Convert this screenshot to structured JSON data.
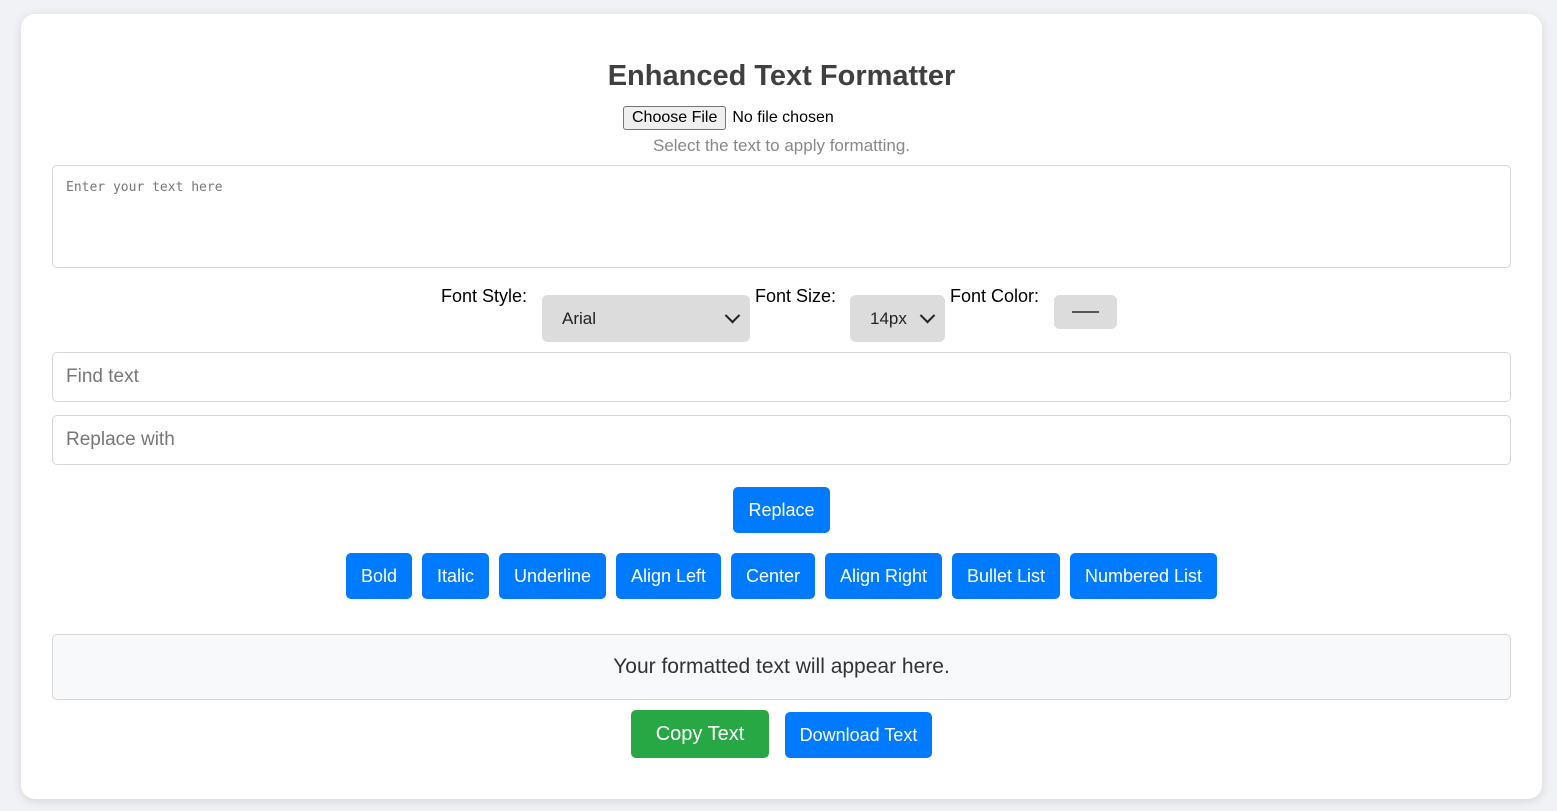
{
  "title": "Enhanced Text Formatter",
  "file_input": {
    "button_label": "Choose File",
    "status": "No file chosen"
  },
  "hint": "Select the text to apply formatting.",
  "editor": {
    "placeholder": "Enter your text here",
    "value": ""
  },
  "options": {
    "font_style_label": "Font Style:",
    "font_style_value": "Arial",
    "font_size_label": "Font Size:",
    "font_size_value": "14px",
    "font_color_label": "Font Color:",
    "font_color_value": "#555555"
  },
  "find": {
    "placeholder": "Find text"
  },
  "replace": {
    "placeholder": "Replace with",
    "button_label": "Replace"
  },
  "toolbar": {
    "bold": "Bold",
    "italic": "Italic",
    "underline": "Underline",
    "align_left": "Align Left",
    "center": "Center",
    "align_right": "Align Right",
    "bullet_list": "Bullet List",
    "numbered_list": "Numbered List"
  },
  "output": {
    "text": "Your formatted text will appear here."
  },
  "actions": {
    "copy": "Copy Text",
    "download": "Download Text"
  },
  "colors": {
    "primary": "#007bff",
    "success": "#28a745",
    "title": "#404040",
    "hint": "#888888"
  }
}
